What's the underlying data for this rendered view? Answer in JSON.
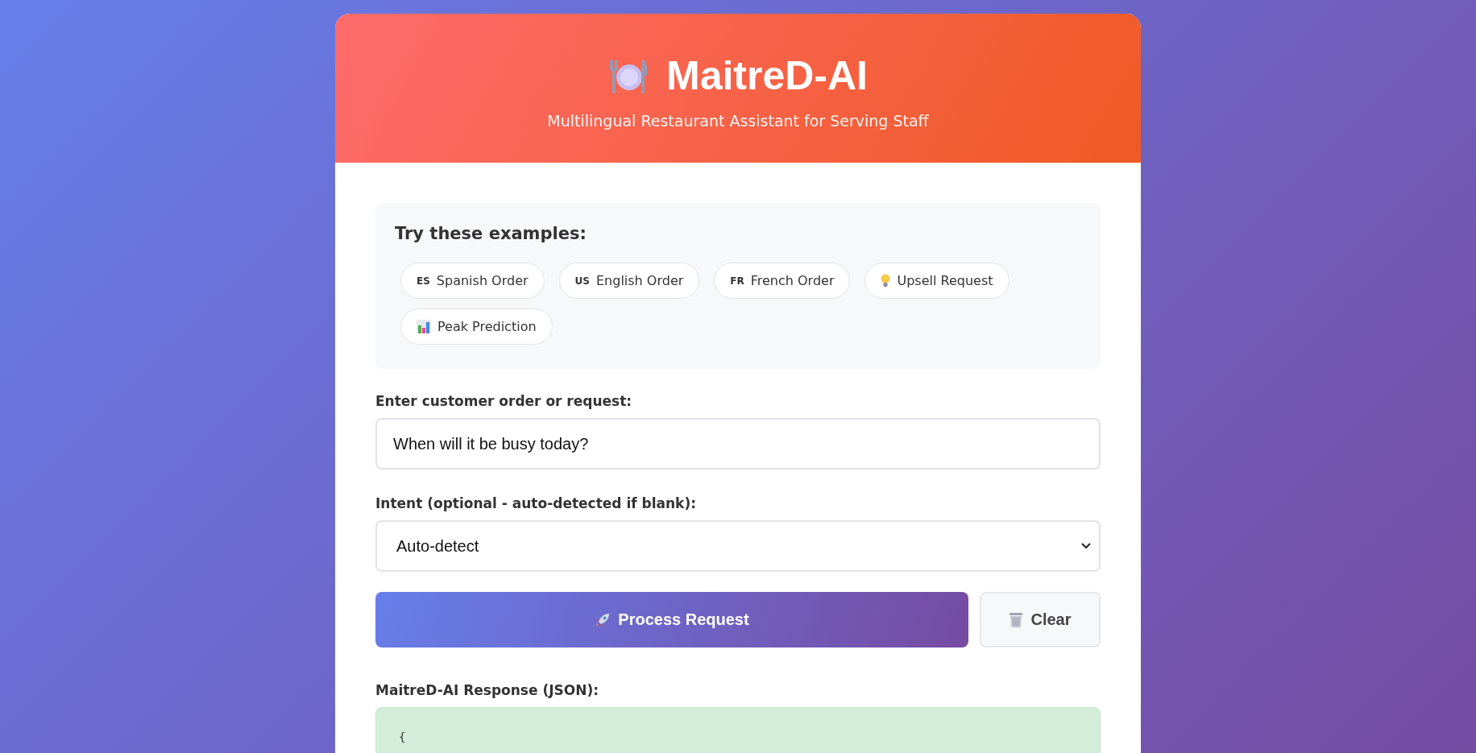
{
  "header": {
    "title": "MaitreD-AI",
    "subtitle": "Multilingual Restaurant Assistant for Serving Staff"
  },
  "examples": {
    "heading": "Try these examples:",
    "items": [
      {
        "kind": "badge",
        "badge": "ES",
        "label": "Spanish Order"
      },
      {
        "kind": "badge",
        "badge": "US",
        "label": "English Order"
      },
      {
        "kind": "badge",
        "badge": "FR",
        "label": "French Order"
      },
      {
        "kind": "bulb",
        "label": "Upsell Request"
      },
      {
        "kind": "chart",
        "label": "Peak Prediction"
      }
    ]
  },
  "order_field": {
    "label": "Enter customer order or request:",
    "value": "When will it be busy today?"
  },
  "intent_field": {
    "label": "Intent (optional - auto-detected if blank):",
    "value": "Auto-detect"
  },
  "buttons": [
    {
      "kind": "primary",
      "label": "Process Request"
    },
    {
      "kind": "secondary",
      "label": "Clear"
    }
  ],
  "response": {
    "label": "MaitreD-AI Response (JSON):",
    "lines": [
      "{"
    ]
  }
}
